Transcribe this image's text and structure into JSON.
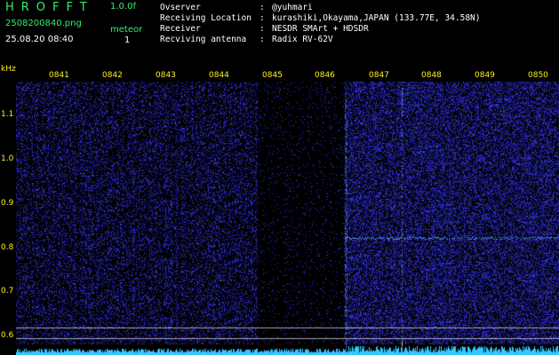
{
  "header": {
    "app_title": "HROFFT",
    "app_version": "1.0.0f",
    "file_name": "2508200840.png",
    "timestamp": "25.08.20 08:40",
    "mode_label": "meteor",
    "mode_count": "1"
  },
  "station_info": [
    {
      "label": "Ovserver",
      "value": "@yuhmari"
    },
    {
      "label": "Receiving Location",
      "value": "kurashiki,Okayama,JAPAN (133.77E, 34.58N)"
    },
    {
      "label": "Receiver",
      "value": "NESDR SMArt + HDSDR"
    },
    {
      "label": "Recviving antenna",
      "value": "Radix RV-62V"
    }
  ],
  "axis": {
    "unit_label": "kHz",
    "time_ticks": [
      "0841",
      "0842",
      "0843",
      "0844",
      "0845",
      "0846",
      "0847",
      "0848",
      "0849",
      "0850"
    ],
    "freq_ticks": [
      "1.1",
      "1.0",
      "0.9",
      "0.8",
      "0.7",
      "0.6"
    ]
  },
  "colors": {
    "background": "#000000",
    "label_green": "#2cf06a",
    "label_yellow": "#ffee22",
    "noise_blue": "#2a2ad8",
    "trace_cyan": "#33c8ff"
  }
}
